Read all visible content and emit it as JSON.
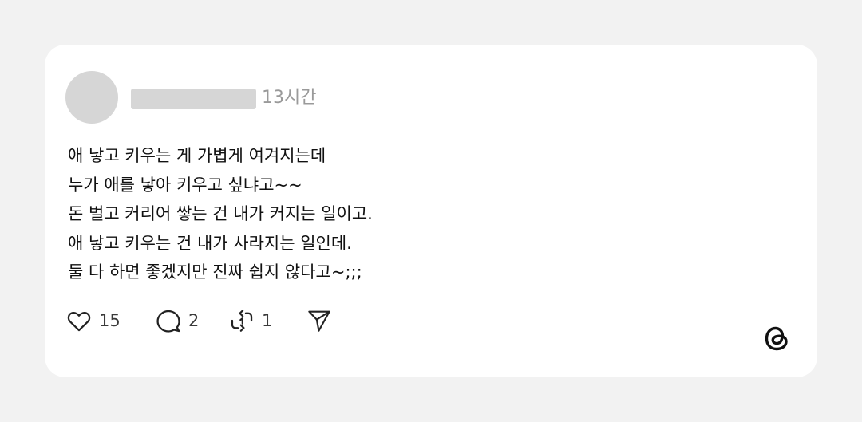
{
  "post": {
    "time": "13시간",
    "lines": [
      "애 낳고 키우는 게 가볍게 여겨지는데",
      "누가 애를 낳아 키우고 싶냐고~~",
      "돈 벌고 커리어 쌓는 건 내가 커지는 일이고.",
      "애 낳고 키우는 건 내가 사라지는 일인데.",
      "둘 다 하면 좋겠지만 진짜 쉽지 않다고~;;;"
    ]
  },
  "actions": {
    "likes": "15",
    "comments": "2",
    "reposts": "1"
  },
  "icons": {
    "like": "heart-icon",
    "comment": "comment-bubble-icon",
    "repost": "repost-icon",
    "share": "send-icon",
    "brand": "threads-logo-icon"
  },
  "colors": {
    "background": "#f2f2f2",
    "card": "#ffffff",
    "placeholder": "#d6d6d6",
    "muted_text": "#9a9a9a",
    "text": "#111111"
  }
}
